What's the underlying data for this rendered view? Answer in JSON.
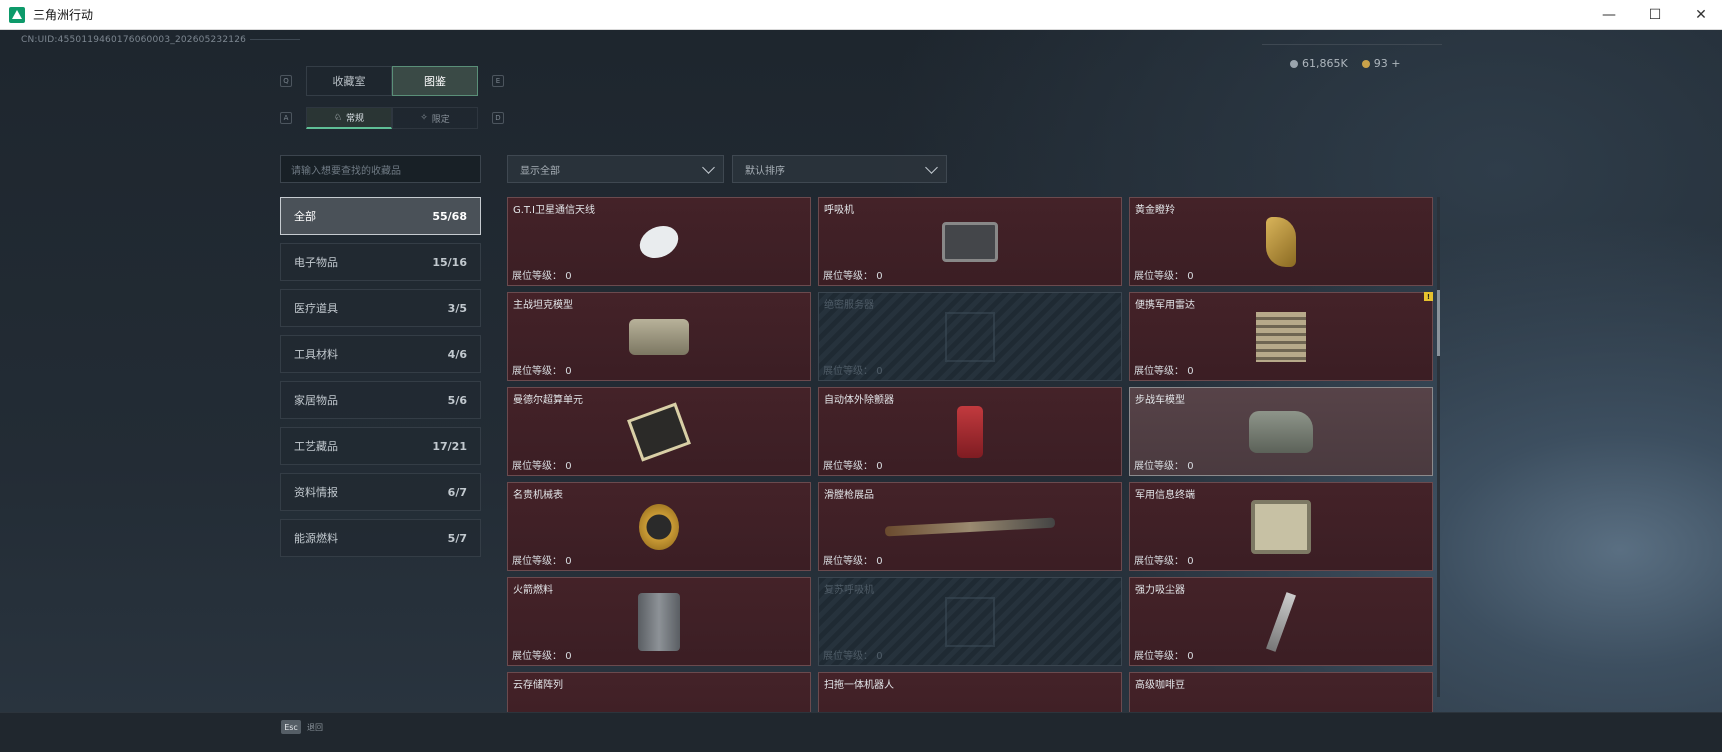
{
  "window": {
    "title": "三角洲行动",
    "minimize": "—",
    "maximize": "☐",
    "close": "✕"
  },
  "uid": "CN:UID:4550119460176060003_202605232126",
  "currency": {
    "silver": "61,865K",
    "gold": "93",
    "add": "+"
  },
  "key_hints": {
    "tab_prev": "Q",
    "tab_next": "E",
    "sub_prev": "A",
    "sub_next": "D"
  },
  "tabs": [
    {
      "label": "收藏室"
    },
    {
      "label": "图鉴"
    }
  ],
  "subtabs": [
    {
      "label": "常规"
    },
    {
      "label": "限定"
    }
  ],
  "search": {
    "placeholder": "请输入想要查找的收藏品"
  },
  "filters": {
    "display": "显示全部",
    "sort": "默认排序"
  },
  "categories": [
    {
      "label": "全部",
      "count": "55/68"
    },
    {
      "label": "电子物品",
      "count": "15/16"
    },
    {
      "label": "医疗道具",
      "count": "3/5"
    },
    {
      "label": "工具材料",
      "count": "4/6"
    },
    {
      "label": "家居物品",
      "count": "5/6"
    },
    {
      "label": "工艺藏品",
      "count": "17/21"
    },
    {
      "label": "资料情报",
      "count": "6/7"
    },
    {
      "label": "能源燃料",
      "count": "5/7"
    }
  ],
  "level_label": "展位等级：",
  "items": [
    {
      "name": "G.T.I卫星通信天线",
      "level": "0",
      "icon": "satellite-dish-icon"
    },
    {
      "name": "呼吸机",
      "level": "0",
      "icon": "ventilator-icon"
    },
    {
      "name": "黄金瞪羚",
      "level": "0",
      "icon": "golden-gazelle-icon"
    },
    {
      "name": "主战坦克模型",
      "level": "0",
      "icon": "tank-model-icon"
    },
    {
      "name": "绝密服务器",
      "level": "0",
      "icon": "server-icon"
    },
    {
      "name": "便携军用雷达",
      "level": "0",
      "icon": "radar-icon"
    },
    {
      "name": "曼德尔超算单元",
      "level": "0",
      "icon": "compute-unit-icon"
    },
    {
      "name": "自动体外除颤器",
      "level": "0",
      "icon": "defibrillator-icon"
    },
    {
      "name": "步战车模型",
      "level": "0",
      "icon": "apc-model-icon"
    },
    {
      "name": "名贵机械表",
      "level": "0",
      "icon": "watch-icon"
    },
    {
      "name": "滑膛枪展品",
      "level": "0",
      "icon": "musket-icon"
    },
    {
      "name": "军用信息终端",
      "level": "0",
      "icon": "terminal-icon"
    },
    {
      "name": "火箭燃料",
      "level": "0",
      "icon": "fuel-can-icon"
    },
    {
      "name": "复苏呼吸机",
      "level": "0",
      "icon": "resuscitator-icon"
    },
    {
      "name": "强力吸尘器",
      "level": "0",
      "icon": "vacuum-icon"
    },
    {
      "name": "云存储阵列",
      "level": "",
      "icon": "storage-array-icon"
    },
    {
      "name": "扫拖一体机器人",
      "level": "",
      "icon": "robot-icon"
    },
    {
      "name": "高级咖啡豆",
      "level": "",
      "icon": "coffee-icon"
    }
  ],
  "badge": "!",
  "esc": {
    "key": "Esc",
    "label": "退回"
  },
  "colors": {
    "accent": "#5fbf96",
    "card": "#3b1e24",
    "badge": "#e6c22e"
  }
}
